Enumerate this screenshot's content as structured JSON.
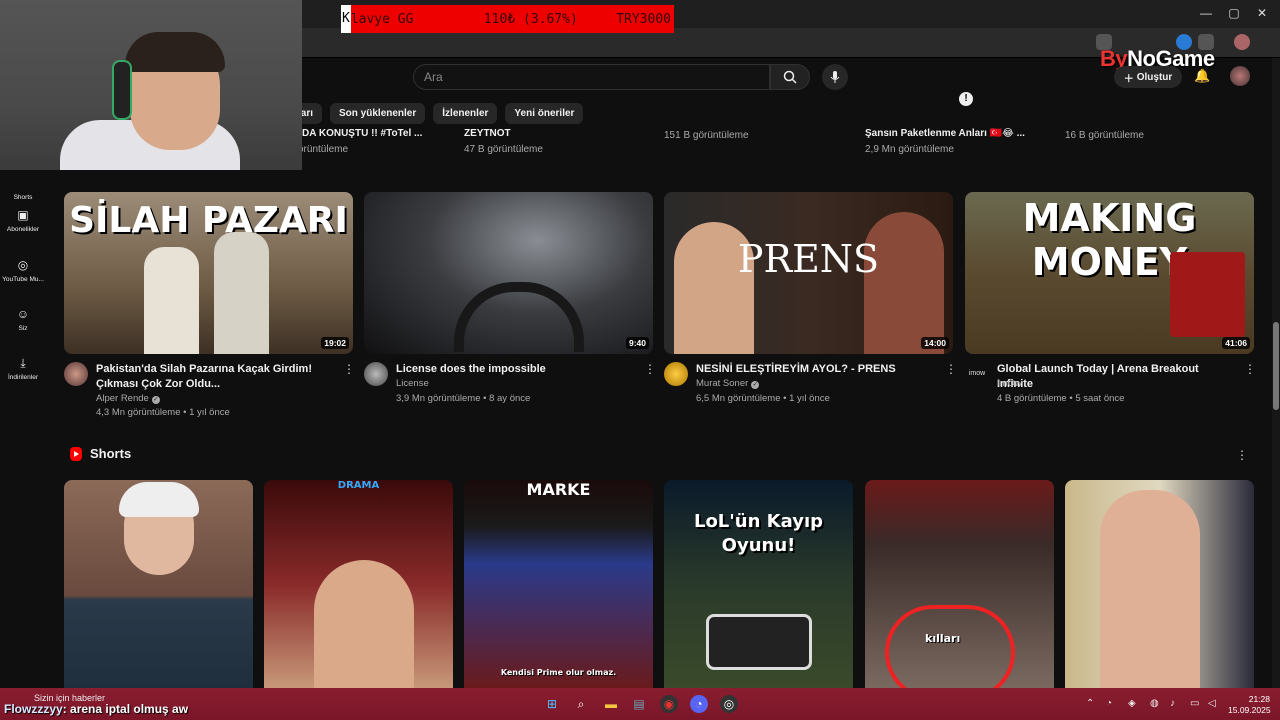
{
  "ticker": {
    "k": "K",
    "name": "lavye GG",
    "change": "110₺ (3.67%)",
    "price": "TRY3000"
  },
  "overlay": {
    "brand_a": "By",
    "brand_b": "NoGame"
  },
  "header": {
    "search_placeholder": "Ara",
    "create_label": "Oluştur"
  },
  "chips": [
    "ları",
    "Son yüklenenler",
    "İzlenenler",
    "Yeni öneriler"
  ],
  "sidebar": [
    {
      "label": "Shorts",
      "icon": "shorts-icon"
    },
    {
      "label": "Abonelikler",
      "icon": "subscriptions-icon"
    },
    {
      "label": "YouTube Mu...",
      "icon": "youtube-music-icon"
    },
    {
      "label": "Siz",
      "icon": "you-icon"
    },
    {
      "label": "İndirilenler",
      "icon": "downloads-icon"
    }
  ],
  "prev_row": [
    {
      "title": "DA KONUŞTU !! #ToTel ...",
      "views": "örüntüleme"
    },
    {
      "title": "ZEYTNOT",
      "views": "47 B görüntüleme"
    },
    {
      "title": "",
      "views": "151 B görüntüleme"
    },
    {
      "title": "Şansın Paketlenme Anları 🇹🇷😂 ...",
      "views": "2,9 Mn görüntüleme"
    },
    {
      "title": "",
      "views": "16 B görüntüleme"
    }
  ],
  "videos": [
    {
      "title": "Pakistan'da Silah Pazarına Kaçak Girdim! Çıkması Çok Zor Oldu...",
      "channel": "Alper Rende",
      "verified": true,
      "meta": "4,3 Mn görüntüleme • 1 yıl önce",
      "duration": "19:02",
      "thumb_text": "SİLAH PAZARI",
      "accent": "#8a6a4a"
    },
    {
      "title": "License does the impossible",
      "channel": "License",
      "verified": false,
      "meta": "3,9 Mn görüntüleme • 8 ay önce",
      "duration": "9:40",
      "thumb_text": "",
      "accent": "#333"
    },
    {
      "title": "NESİNİ ELEŞTİREYİM AYOL? - PRENS",
      "channel": "Murat Soner",
      "verified": true,
      "meta": "6,5 Mn görüntüleme • 1 yıl önce",
      "duration": "14:00",
      "thumb_text": "PRENS",
      "accent": "#3a2a20"
    },
    {
      "title": "Global Launch Today | Arena Breakout Infinite",
      "channel": "ImOw",
      "verified": false,
      "meta": "4 B görüntüleme • 5 saat önce",
      "duration": "41:06",
      "thumb_text": "MAKING MONEY",
      "accent": "#7a5a30"
    }
  ],
  "shorts_section": {
    "title": "Shorts"
  },
  "shorts": [
    {
      "caption": "",
      "top_text": ""
    },
    {
      "caption": "",
      "top_text": "DRAMA"
    },
    {
      "caption": "Kendisi Prime olur olmaz.",
      "top_text": "MARKE"
    },
    {
      "caption": "",
      "top_text": "LoL'ün Kayıp Oyunu!"
    },
    {
      "caption": "kılları",
      "top_text": ""
    },
    {
      "caption": "",
      "top_text": ""
    }
  ],
  "taskbar": {
    "news": "Sizin için haberler",
    "chat_user": "Flowzzzyy",
    "chat_text": ": arena iptal olmuş aw",
    "time": "21:28",
    "date": "15.09.2025"
  }
}
